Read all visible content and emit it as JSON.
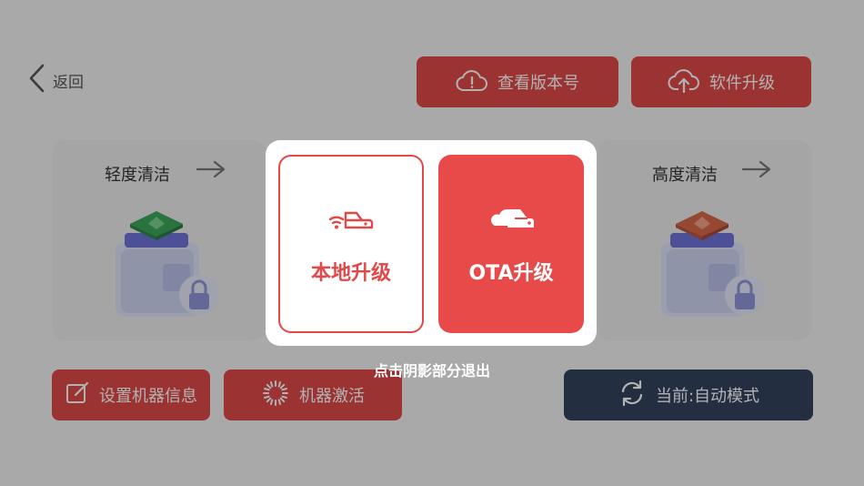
{
  "header": {
    "back_label": "返回",
    "check_version_label": "查看版本号",
    "software_upgrade_label": "软件升级"
  },
  "cards": {
    "light_clean": {
      "title": "轻度清洁",
      "icon": "locked-cleaning-box-icon"
    },
    "deep_clean": {
      "title": "高度清洁",
      "icon": "locked-cleaning-box-icon"
    }
  },
  "footer": {
    "set_machine_info_label": "设置机器信息",
    "machine_activate_label": "机器激活",
    "current_mode_label": "当前:自动模式"
  },
  "modal": {
    "local_upgrade_label": "本地升级",
    "ota_upgrade_label": "OTA升级",
    "dismiss_hint": "点击阴影部分退出"
  },
  "colors": {
    "accent_red": "#e24848",
    "dark_button": "#33425e",
    "overlay": "rgba(0,0,0,0.30)"
  }
}
